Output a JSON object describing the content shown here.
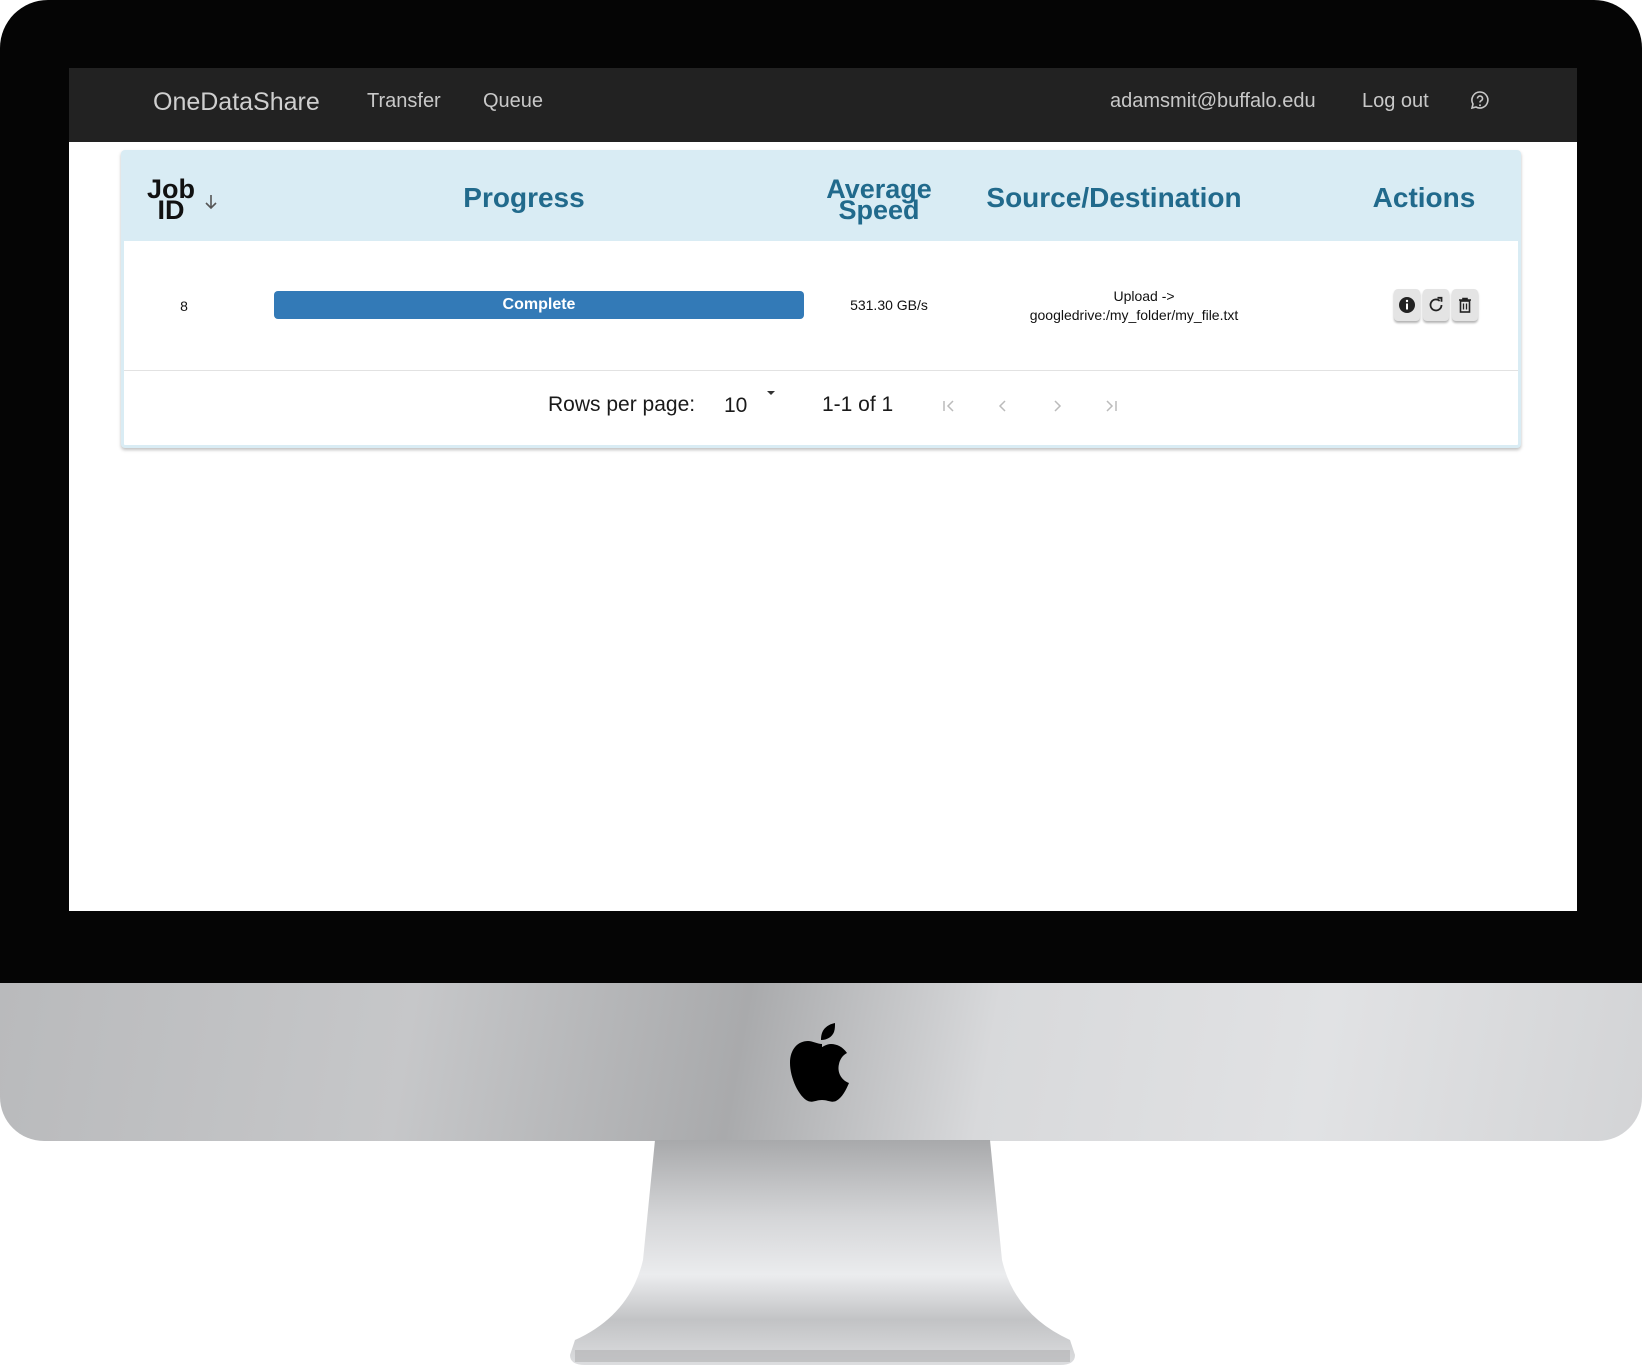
{
  "navbar": {
    "brand": "OneDataShare",
    "links": [
      "Transfer",
      "Queue"
    ],
    "user_email": "adamsmit@buffalo.edu",
    "logout_label": "Log out",
    "help_icon": "help-circle-icon"
  },
  "table": {
    "columns": {
      "job_id_line1": "Job",
      "job_id_line2": "ID",
      "progress": "Progress",
      "avg_speed_line1": "Average",
      "avg_speed_line2": "Speed",
      "source_destination": "Source/Destination",
      "actions": "Actions"
    },
    "sort_icon": "arrow-down-icon",
    "rows": [
      {
        "job_id": "8",
        "progress_label": "Complete",
        "progress_percent": 100,
        "average_speed": "531.30 GB/s",
        "source": "Upload ->",
        "destination": "googledrive:/my_folder/my_file.txt",
        "action_icons": [
          "info-icon",
          "restart-icon",
          "trash-icon"
        ]
      }
    ]
  },
  "pagination": {
    "rows_per_page_label": "Rows per page:",
    "rows_per_page_value": "10",
    "range_text": "1-1 of 1"
  },
  "colors": {
    "navbar_bg": "#222222",
    "header_bg": "#d9ecf4",
    "header_text": "#216a8c",
    "progress_fill": "#337ab7"
  }
}
